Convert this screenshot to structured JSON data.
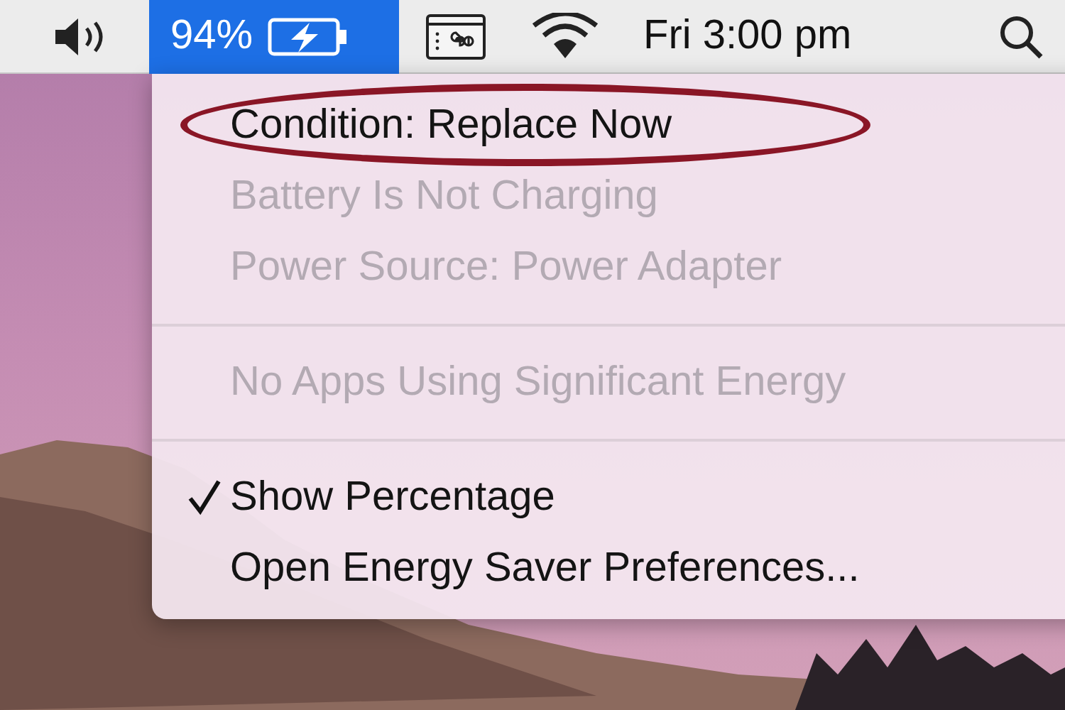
{
  "menu_bar": {
    "battery": {
      "percent": "94%",
      "selected": true
    },
    "clock": "Fri 3:00 pm"
  },
  "menu": {
    "items": [
      {
        "kind": "item",
        "label": "Condition: Replace Now",
        "disabled": false,
        "checked": false,
        "circled": true
      },
      {
        "kind": "item",
        "label": "Battery Is Not Charging",
        "disabled": true,
        "checked": false,
        "circled": false
      },
      {
        "kind": "item",
        "label": "Power Source: Power Adapter",
        "disabled": true,
        "checked": false,
        "circled": false
      },
      {
        "kind": "separator"
      },
      {
        "kind": "item",
        "label": "No Apps Using Significant Energy",
        "disabled": true,
        "checked": false,
        "circled": false
      },
      {
        "kind": "separator"
      },
      {
        "kind": "item",
        "label": "Show Percentage",
        "disabled": false,
        "checked": true,
        "circled": false
      },
      {
        "kind": "item",
        "label": "Open Energy Saver Preferences...",
        "disabled": false,
        "checked": false,
        "circled": false
      }
    ]
  }
}
